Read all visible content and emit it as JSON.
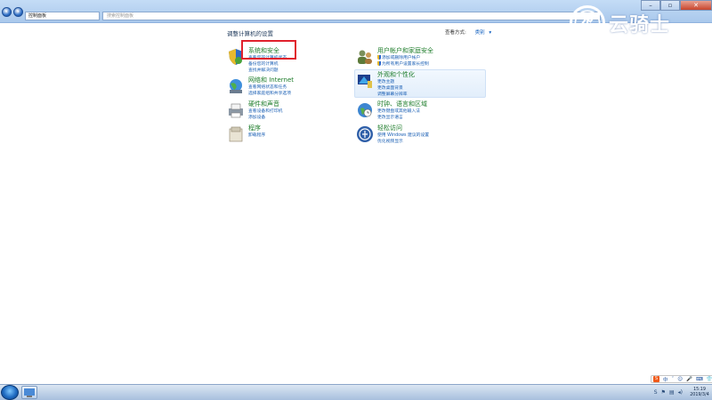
{
  "window": {
    "address": "控制面板",
    "search_placeholder": "搜索控制面板",
    "controls": [
      "–",
      "▫",
      "✕"
    ]
  },
  "watermark": {
    "text": "云骑士"
  },
  "header": {
    "title": "调整计算机的设置",
    "view_by_label": "查看方式:",
    "view_by_value": "类别"
  },
  "categories": [
    {
      "title": "系统和安全",
      "links": [
        "查看您的计算机状态",
        "备份您的计算机",
        "查找并解决问题"
      ]
    },
    {
      "title": "网络和 Internet",
      "links": [
        "查看网络状态和任务",
        "选择家庭组和共享选项"
      ]
    },
    {
      "title": "硬件和声音",
      "links": [
        "查看设备和打印机",
        "添加设备"
      ]
    },
    {
      "title": "程序",
      "links": [
        "卸载程序"
      ]
    },
    {
      "title": "用户帐户和家庭安全",
      "links": [
        "添加或删除用户帐户",
        "为所有用户设置家长控制"
      ]
    },
    {
      "title": "外观和个性化",
      "links": [
        "更改主题",
        "更改桌面背景",
        "调整屏幕分辨率"
      ]
    },
    {
      "title": "时钟、语言和区域",
      "links": [
        "更改键盘或其他输入法",
        "更改显示语言"
      ]
    },
    {
      "title": "轻松访问",
      "links": [
        "使用 Windows 建议的设置",
        "优化视频显示"
      ]
    }
  ],
  "taskbar": {
    "ime": [
      "S",
      "中",
      "ˇ",
      "☺",
      "🎤",
      "⌨",
      "👕",
      "⚙"
    ],
    "time": "15:19",
    "date": "2019/3/4"
  },
  "colors": {
    "category_title": "#1d7c2a",
    "link": "#1a5fb4",
    "highlight_box": "#e0212c"
  }
}
